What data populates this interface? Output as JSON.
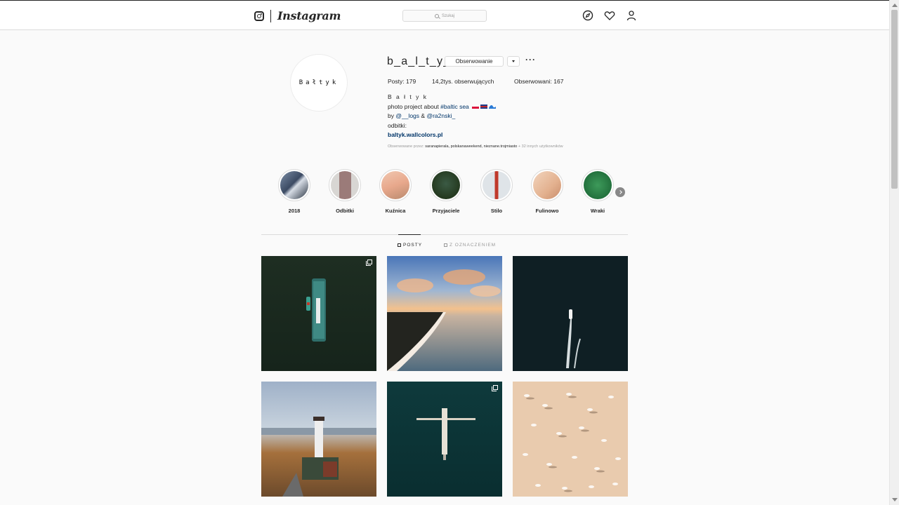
{
  "header": {
    "brand": "Instagram",
    "search_placeholder": "Szukaj",
    "nav_icons": [
      "compass-icon",
      "heart-icon",
      "user-icon"
    ]
  },
  "profile": {
    "avatar_text": "Bałtyk",
    "username": "b_a_l_t_y_k",
    "follow_button": "Obserwowanie",
    "more": "···",
    "stats": {
      "posts_label": "Posty:",
      "posts_value": "179",
      "followers_value": "14,2tys.",
      "followers_label": "obserwujących",
      "following_label": "Obserwowani:",
      "following_value": "167"
    },
    "bio": {
      "name": "B a ł t y k",
      "line1_text": "photo project about ",
      "line1_tag": "#baltic sea",
      "line2_prefix": "by ",
      "line2_mention1": "@__logs",
      "line2_amp": " & ",
      "line2_mention2": "@ra2nski_",
      "line3": "odbitki:",
      "link": "baltyk.wallcolors.pl"
    },
    "followed_by": {
      "prefix": "Obserwowane przez: ",
      "users": "saranapierala, polskanaweekend, nieznane.trojmiasto",
      "suffix": " + 32 innych użytkowników"
    }
  },
  "highlights": [
    {
      "label": "2018",
      "color": "#5a6f88"
    },
    {
      "label": "Odbitki",
      "color": "#8a7a76"
    },
    {
      "label": "Kuźnica",
      "color": "#e4b39a"
    },
    {
      "label": "Przyjaciele",
      "color": "#2f4a2a"
    },
    {
      "label": "Stilo",
      "color": "#cfd6dc"
    },
    {
      "label": "Fulinowo",
      "color": "#e5c1a2"
    },
    {
      "label": "Wraki",
      "color": "#2f7b45"
    }
  ],
  "tabs": {
    "posts": "POSTY",
    "tagged": "Z OZNACZENIEM"
  },
  "posts": [
    {
      "scene": "ferry-on-dark-water",
      "multi": true
    },
    {
      "scene": "coast-at-sunset",
      "multi": false
    },
    {
      "scene": "boat-wake-dark-sea",
      "multi": false
    },
    {
      "scene": "lighthouse-autumn-forest",
      "multi": false
    },
    {
      "scene": "pier-over-green-water",
      "multi": true
    },
    {
      "scene": "birds-on-sand",
      "multi": false
    }
  ]
}
